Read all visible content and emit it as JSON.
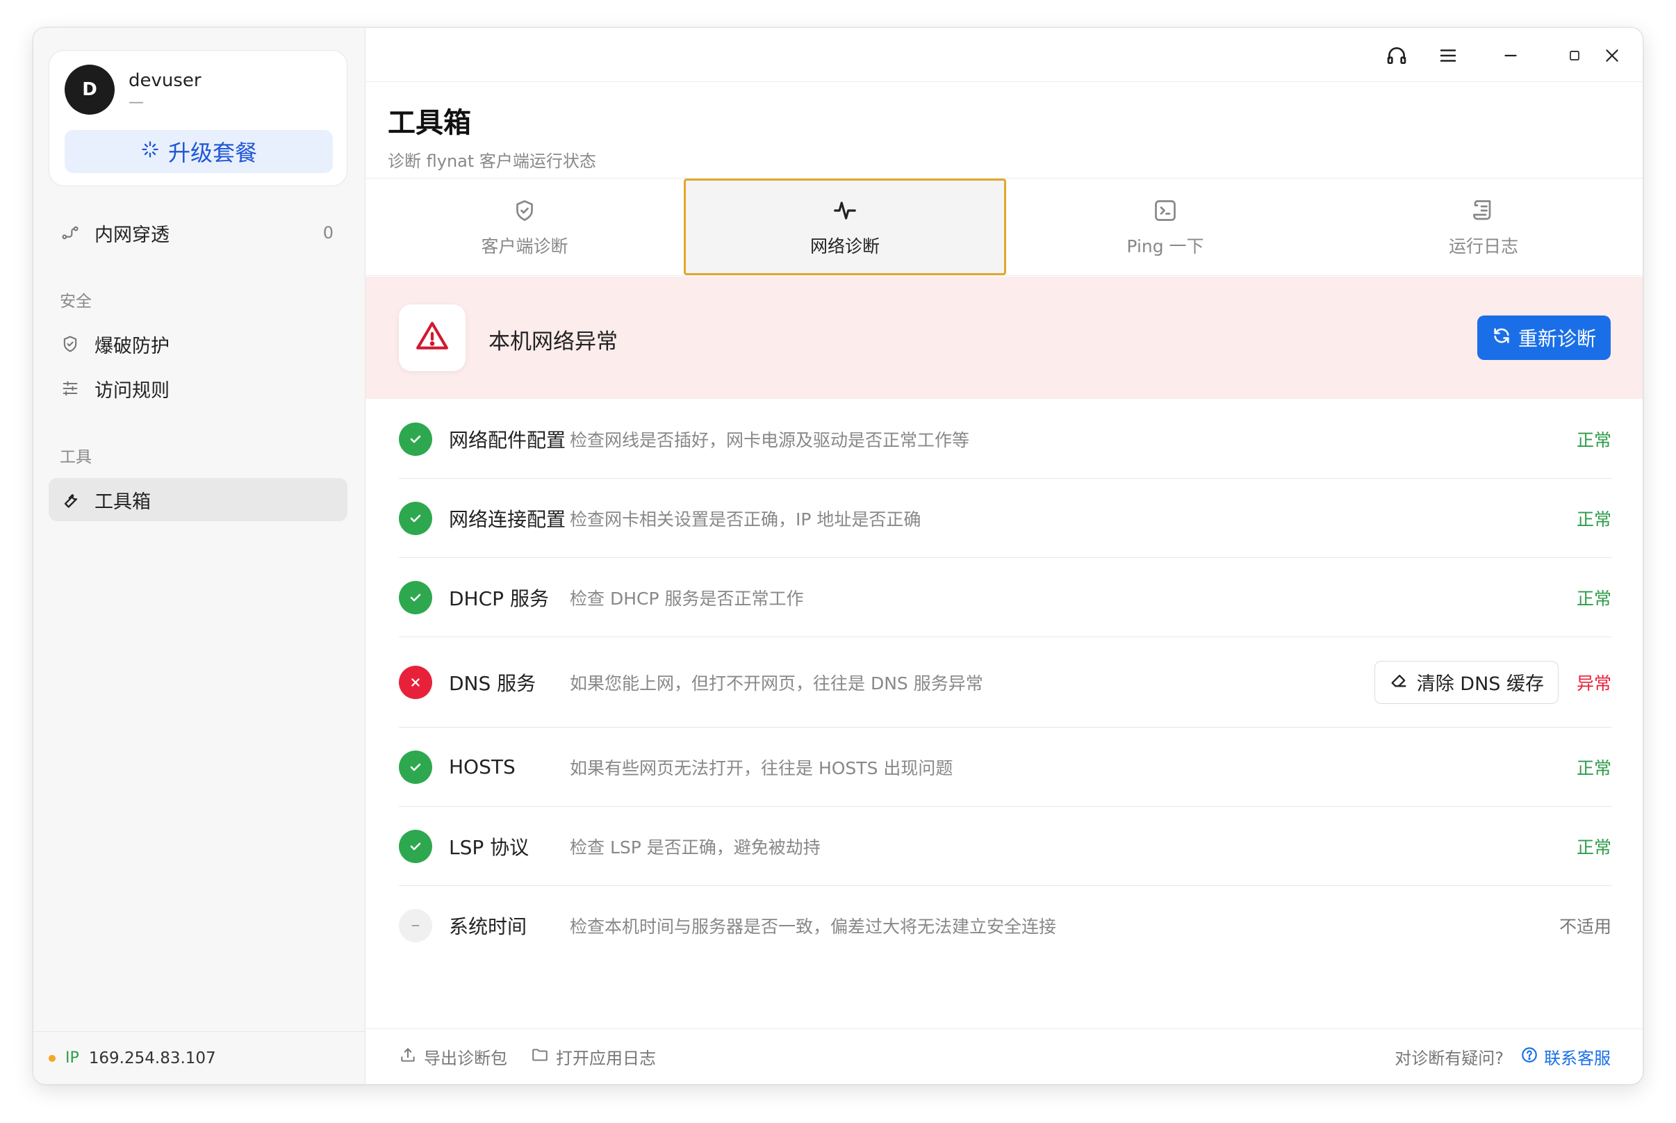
{
  "sidebar": {
    "user": {
      "avatar_letter": "D",
      "name": "devuser",
      "sub": "—"
    },
    "upgrade_label": "升级套餐",
    "nav_tunnel": {
      "label": "内网穿透",
      "count": "0"
    },
    "section_security": "安全",
    "nav_bruteforce": "爆破防护",
    "nav_access_rules": "访问规则",
    "section_tools": "工具",
    "nav_toolbox": "工具箱",
    "footer": {
      "ip_tag": "IP",
      "ip": "169.254.83.107"
    }
  },
  "header": {
    "title": "工具箱",
    "subtitle": "诊断 flynat 客户端运行状态"
  },
  "tabs": [
    {
      "label": "客户端诊断",
      "icon": "shield-check-icon"
    },
    {
      "label": "网络诊断",
      "icon": "activity-icon"
    },
    {
      "label": "Ping 一下",
      "icon": "terminal-icon"
    },
    {
      "label": "运行日志",
      "icon": "scroll-icon"
    }
  ],
  "alert": {
    "title": "本机网络异常",
    "button_label": "重新诊断"
  },
  "checks": [
    {
      "name": "网络配件配置",
      "desc": "检查网线是否插好，网卡电源及驱动是否正常工作等",
      "state": "正常",
      "status": "ok"
    },
    {
      "name": "网络连接配置",
      "desc": "检查网卡相关设置是否正确，IP 地址是否正确",
      "state": "正常",
      "status": "ok"
    },
    {
      "name": "DHCP 服务",
      "desc": "检查 DHCP 服务是否正常工作",
      "state": "正常",
      "status": "ok"
    },
    {
      "name": "DNS 服务",
      "desc": "如果您能上网，但打不开网页，往往是 DNS 服务异常",
      "state": "异常",
      "status": "error",
      "action_label": "清除 DNS 缓存"
    },
    {
      "name": "HOSTS",
      "desc": "如果有些网页无法打开，往往是 HOSTS 出现问题",
      "state": "正常",
      "status": "ok"
    },
    {
      "name": "LSP 协议",
      "desc": "检查 LSP 是否正确，避免被劫持",
      "state": "正常",
      "status": "ok"
    },
    {
      "name": "系统时间",
      "desc": "检查本机时间与服务器是否一致，偏差过大将无法建立安全连接",
      "state": "不适用",
      "status": "na"
    }
  ],
  "footer": {
    "export_label": "导出诊断包",
    "open_log_label": "打开应用日志",
    "question_label": "对诊断有疑问?",
    "contact_label": "联系客服"
  },
  "colors": {
    "accent": "#1a6fe8",
    "ok": "#2ea84f",
    "error": "#e8213a",
    "alert_bg": "#fdecec",
    "tab_active_border": "#e2a72b"
  }
}
